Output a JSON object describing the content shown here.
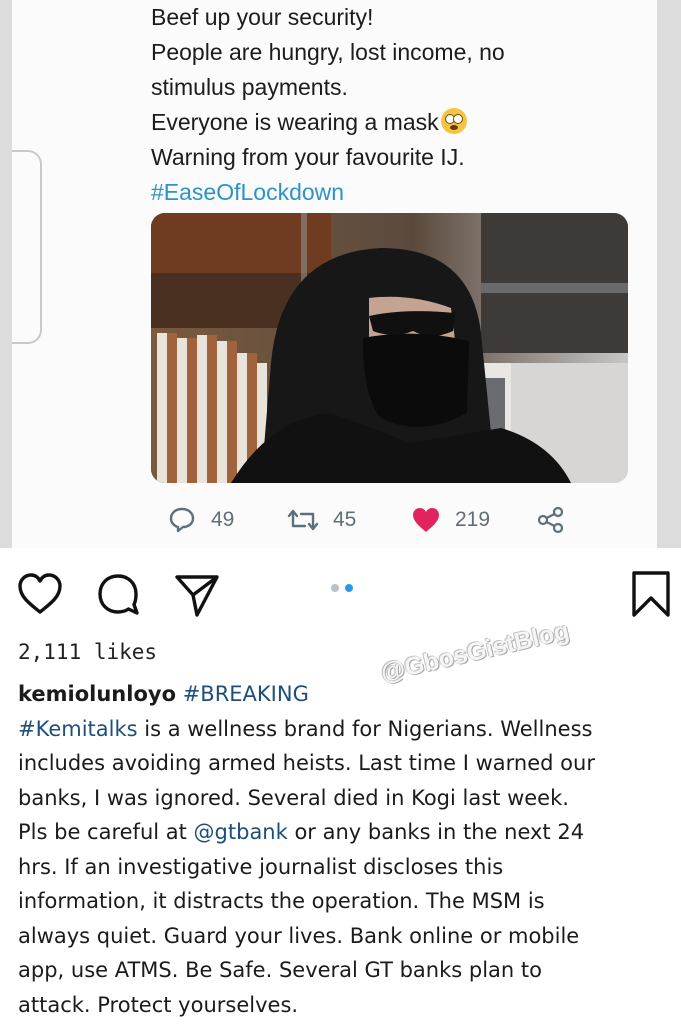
{
  "tweet": {
    "lines": [
      "Beef up your security!",
      "People are hungry, lost income, no",
      "stimulus payments.",
      "Everyone is wearing a mask",
      "Warning from your favourite IJ."
    ],
    "hashtag": "#EaseOfLockdown",
    "emoji": "flushed-face-emoji",
    "replies": "49",
    "retweets": "45",
    "likes": "219",
    "like_color": "#e0245e",
    "hashtag_color": "#2d93c9",
    "photo_description_icon": "masked-person-photo"
  },
  "post": {
    "likes_text": "2,111 likes",
    "carousel": {
      "count": 2,
      "active_index": 1
    },
    "watermark": "@GbosGistBlog",
    "username": "kemiolunloyo",
    "caption_lead_tag": "#BREAKING",
    "caption_lines": [
      [
        "#Kemitalks",
        " is a wellness brand for Nigerians. Wellness"
      ],
      [
        "",
        "includes avoiding armed heists. Last time I warned our"
      ],
      [
        "",
        "banks, I was ignored. Several died in Kogi last week."
      ],
      [
        "",
        "Pls be careful at "
      ],
      [
        "",
        "hrs. If an investigative journalist discloses this"
      ],
      [
        "",
        "information, it distracts the operation. The MSM is"
      ],
      [
        "",
        "always quiet. Guard your lives. Bank online or mobile"
      ],
      [
        "",
        "app, use ATMS. Be Safe. Several GT banks plan to"
      ],
      [
        "",
        "attack. Protect yourselves."
      ]
    ],
    "mention": "@gtbank",
    "mention_tail": " or any banks in the next 24",
    "accent_color": "#2f97e8"
  }
}
